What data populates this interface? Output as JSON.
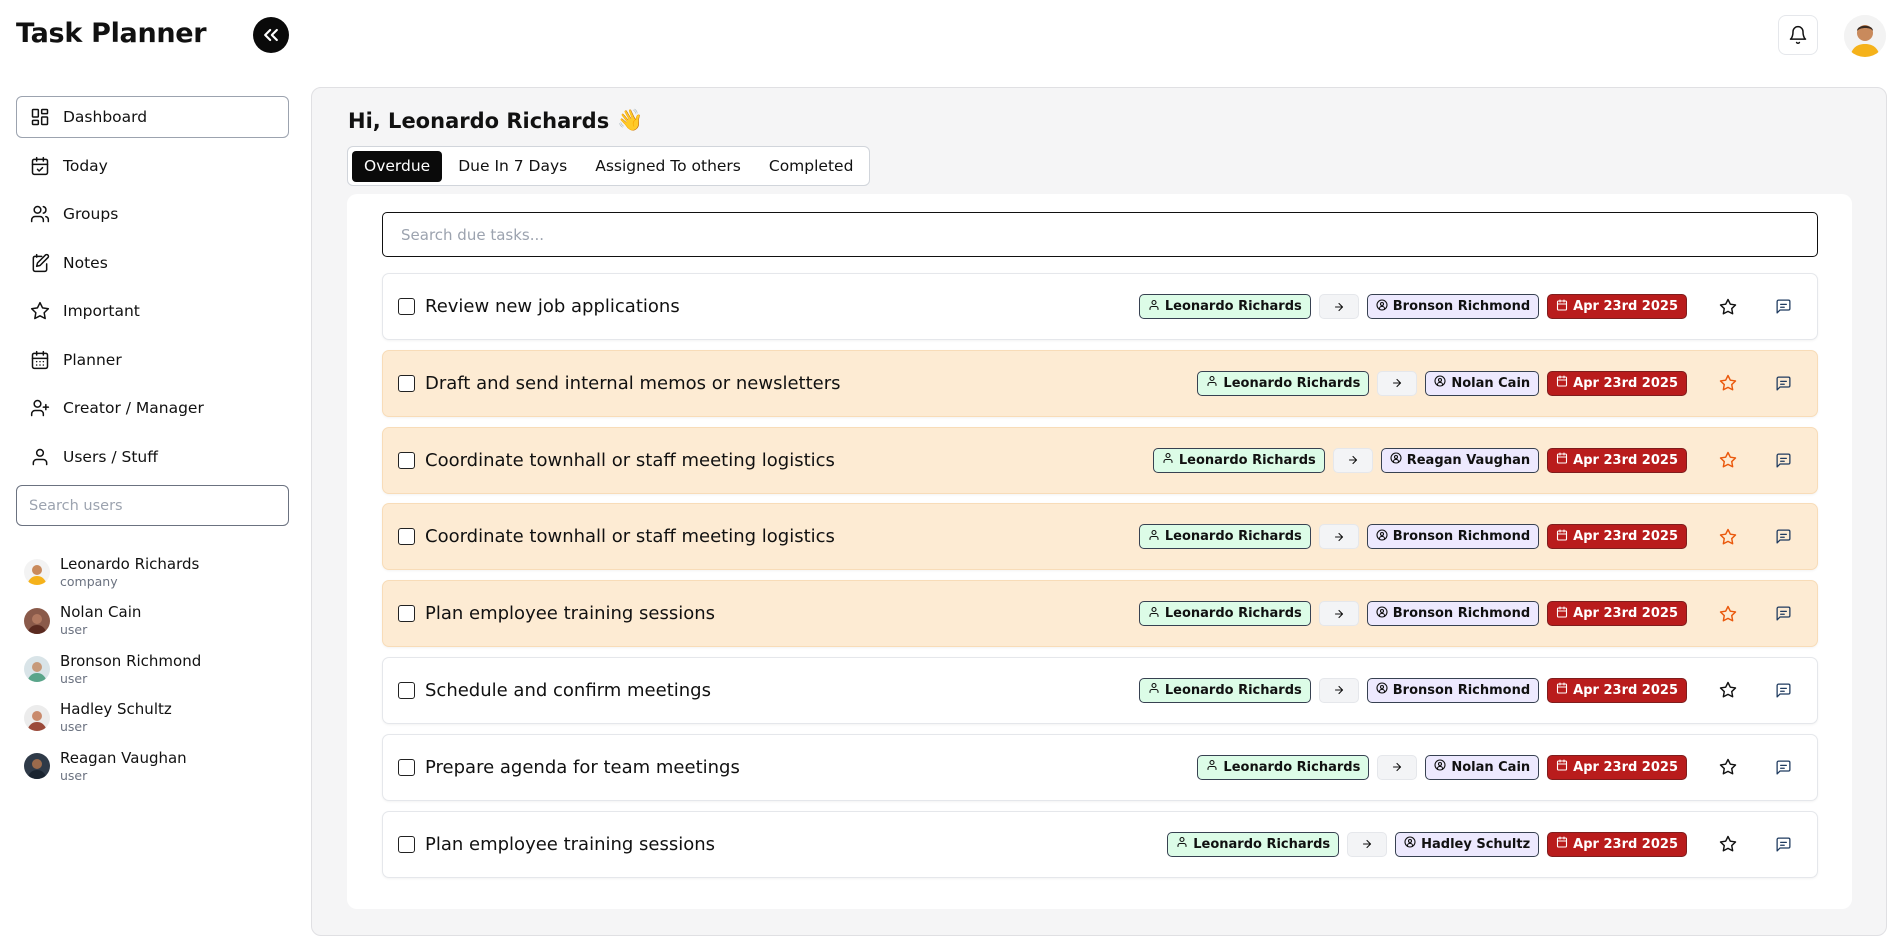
{
  "app": {
    "title": "Task Planner"
  },
  "sidebar": {
    "nav": [
      {
        "label": "Dashboard",
        "icon": "dashboard-icon",
        "active": true
      },
      {
        "label": "Today",
        "icon": "calendar-check-icon"
      },
      {
        "label": "Groups",
        "icon": "users-icon"
      },
      {
        "label": "Notes",
        "icon": "notes-icon"
      },
      {
        "label": "Important",
        "icon": "star-icon"
      },
      {
        "label": "Planner",
        "icon": "calendar-icon"
      },
      {
        "label": "Creator / Manager",
        "icon": "user-plus-icon"
      },
      {
        "label": "Users / Stuff",
        "icon": "user-icon"
      }
    ],
    "search_placeholder": "Search users",
    "users": [
      {
        "name": "Leonardo Richards",
        "role": "company"
      },
      {
        "name": "Nolan Cain",
        "role": "user"
      },
      {
        "name": "Bronson Richmond",
        "role": "user"
      },
      {
        "name": "Hadley Schultz",
        "role": "user"
      },
      {
        "name": "Reagan Vaughan",
        "role": "user"
      }
    ]
  },
  "main": {
    "greeting": "Hi, Leonardo Richards",
    "greeting_emoji": "👋",
    "tabs": [
      {
        "label": "Overdue",
        "active": true
      },
      {
        "label": "Due In 7 Days"
      },
      {
        "label": "Assigned To others"
      },
      {
        "label": "Completed"
      }
    ],
    "search_placeholder": "Search due tasks...",
    "tasks": [
      {
        "title": "Review new job applications",
        "creator": "Leonardo Richards",
        "assignee": "Bronson Richmond",
        "due": "Apr 23rd 2025",
        "highlighted": false
      },
      {
        "title": "Draft and send internal memos or newsletters",
        "creator": "Leonardo Richards",
        "assignee": "Nolan Cain",
        "due": "Apr 23rd 2025",
        "highlighted": true
      },
      {
        "title": "Coordinate townhall or staff meeting logistics",
        "creator": "Leonardo Richards",
        "assignee": "Reagan Vaughan",
        "due": "Apr 23rd 2025",
        "highlighted": true
      },
      {
        "title": "Coordinate townhall or staff meeting logistics",
        "creator": "Leonardo Richards",
        "assignee": "Bronson Richmond",
        "due": "Apr 23rd 2025",
        "highlighted": true
      },
      {
        "title": "Plan employee training sessions",
        "creator": "Leonardo Richards",
        "assignee": "Bronson Richmond",
        "due": "Apr 23rd 2025",
        "highlighted": true
      },
      {
        "title": "Schedule and confirm meetings",
        "creator": "Leonardo Richards",
        "assignee": "Bronson Richmond",
        "due": "Apr 23rd 2025",
        "highlighted": false
      },
      {
        "title": "Prepare agenda for team meetings",
        "creator": "Leonardo Richards",
        "assignee": "Nolan Cain",
        "due": "Apr 23rd 2025",
        "highlighted": false
      },
      {
        "title": "Plan employee training sessions",
        "creator": "Leonardo Richards",
        "assignee": "Hadley Schultz",
        "due": "Apr 23rd 2025",
        "highlighted": false
      }
    ]
  },
  "colors": {
    "highlight_row": "#fdebd3",
    "due_chip": "#b91c1c",
    "creator_chip": "#dcfce7",
    "assignee_chip": "#ede9fe",
    "star_highlight": "#ea580c",
    "comment_icon": "#1e3a5f"
  }
}
